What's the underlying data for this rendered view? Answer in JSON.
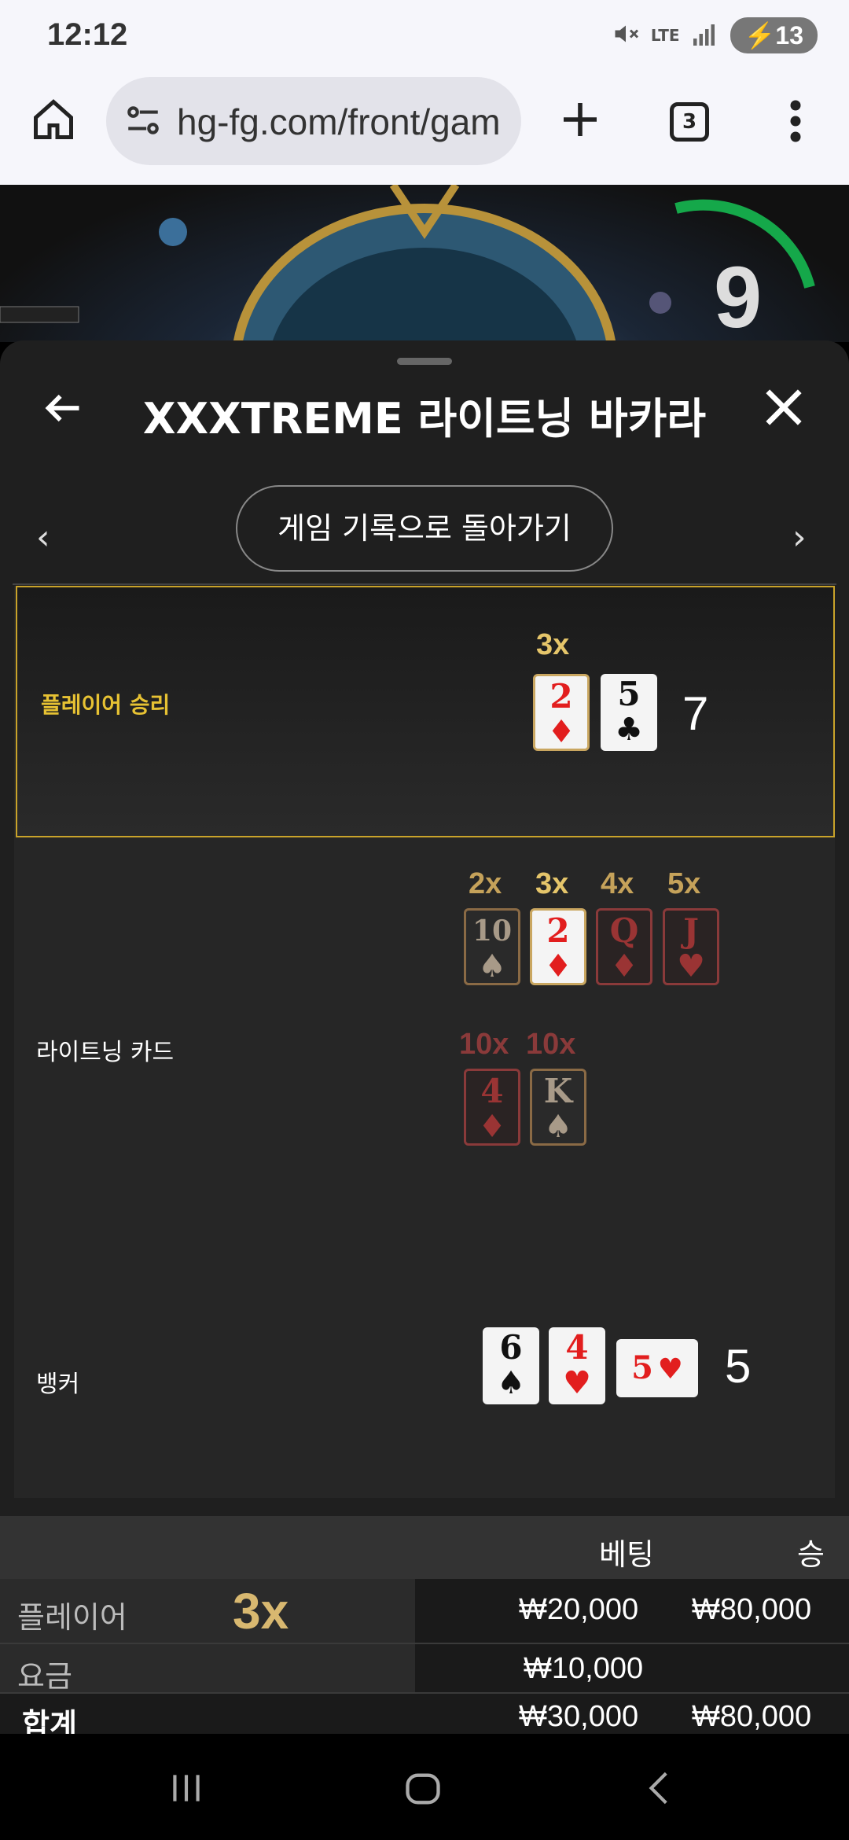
{
  "status": {
    "time": "12:12",
    "battery": "13",
    "network": "LTE"
  },
  "browser": {
    "url": "hg-fg.com/front/gam",
    "tab_count": "3"
  },
  "game": {
    "timer": "9"
  },
  "panel": {
    "title": "XXXTREME 라이트닝 바카라",
    "return_button": "게임 기록으로 돌아가기"
  },
  "result": {
    "player_label": "플레이어 승리",
    "player_multiplier": "3x",
    "player_cards": [
      {
        "rank": "2",
        "suit": "♦"
      },
      {
        "rank": "5",
        "suit": "♣"
      }
    ],
    "player_score": "7",
    "lightning_label": "라이트닝 카드",
    "lightning_row1": [
      {
        "mult": "2x",
        "rank": "10",
        "suit": "♠"
      },
      {
        "mult": "3x",
        "rank": "2",
        "suit": "♦"
      },
      {
        "mult": "4x",
        "rank": "Q",
        "suit": "♦"
      },
      {
        "mult": "5x",
        "rank": "J",
        "suit": "♥"
      }
    ],
    "lightning_row2": [
      {
        "mult": "10x",
        "rank": "4",
        "suit": "♦"
      },
      {
        "mult": "10x",
        "rank": "K",
        "suit": "♠"
      }
    ],
    "banker_label": "뱅커",
    "banker_cards": [
      {
        "rank": "6",
        "suit": "♠"
      },
      {
        "rank": "4",
        "suit": "♥"
      },
      {
        "rank": "5",
        "suit": "♥"
      }
    ],
    "banker_score": "5"
  },
  "table": {
    "headers": {
      "bet": "베팅",
      "win": "승"
    },
    "rows": [
      {
        "label": "플레이어",
        "multiplier": "3x",
        "bet": "₩20,000",
        "win": "₩80,000"
      },
      {
        "label": "요금",
        "bet": "₩10,000",
        "win": ""
      },
      {
        "label": "합계",
        "bet": "₩30,000",
        "win": "₩80,000"
      }
    ]
  }
}
